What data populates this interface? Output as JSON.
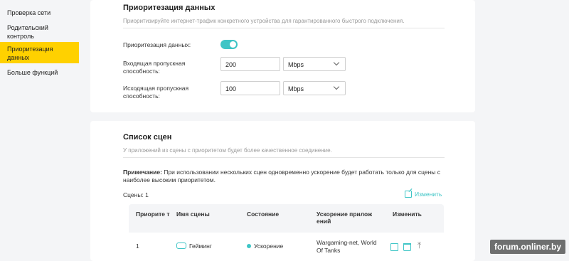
{
  "sidebar": {
    "items": [
      {
        "label": "Проверка сети"
      },
      {
        "label": "Родительский контроль"
      },
      {
        "label": "Приоритезация данных"
      },
      {
        "label": "Больше функций"
      }
    ]
  },
  "priority": {
    "title": "Приоритезация данных",
    "description": "Приоритизируйте интернет-трафик конкретного устройства для гарантированного быстрого подключения.",
    "toggle_label": "Приоритезация данных:",
    "toggle_on": true,
    "download_label": "Входящая пропускная способность:",
    "download_value": "200",
    "download_unit": "Mbps",
    "upload_label": "Исходящая пропускная способность:",
    "upload_value": "100",
    "upload_unit": "Mbps"
  },
  "scenes": {
    "title": "Список сцен",
    "description": "У приложений из сцены с приоритетом будет более качественное соединение.",
    "note_bold": "Примечание:",
    "note_text": " При использовании нескольких сцен одновременно ускорение будет работать только для сцены с наиболее высоким приоритетом.",
    "count": "Сцены: 1",
    "edit_label": "Изменить",
    "columns": [
      "Приорите т",
      "Имя сцены",
      "Состояние",
      "Ускорение прилож ений",
      "Изменить"
    ],
    "rows": [
      {
        "priority": "1",
        "name": "Гейминг",
        "state": "Ускорение",
        "apps": "Wargaming-net, World Of Tanks"
      }
    ]
  },
  "watermark": "forum.onliner.by",
  "colors": {
    "accent": "#3ec5c6",
    "active": "#ffd100"
  }
}
